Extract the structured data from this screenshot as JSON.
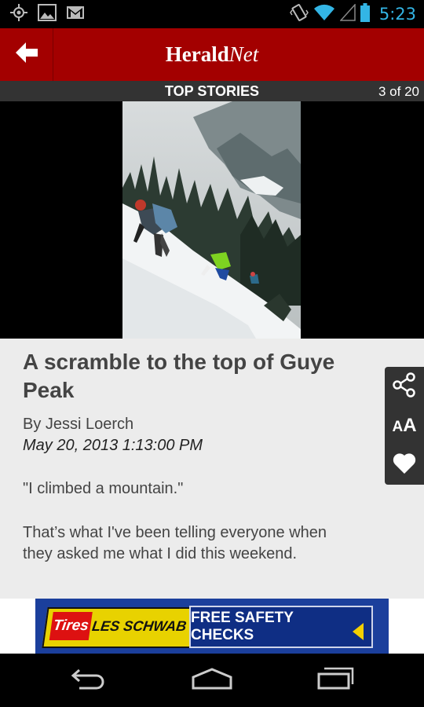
{
  "status_bar": {
    "time": "5:23",
    "icons": [
      "gps-icon",
      "image-icon",
      "gmail-icon",
      "vibrate-icon",
      "wifi-icon",
      "signal-icon",
      "battery-icon"
    ]
  },
  "header": {
    "logo_bold": "Herald",
    "logo_italic": "Net",
    "back_icon": "back-arrow-icon",
    "brand_color": "#a30000"
  },
  "section": {
    "title": "TOP STORIES",
    "counter": "3 of 20"
  },
  "article": {
    "headline": "A scramble to the top of Guye Peak",
    "byline": "By Jessi Loerch",
    "date": "May 20, 2013 1:13:00 PM",
    "paragraphs": [
      "\"I climbed a mountain.\"",
      "That’s what I've been telling everyone when they asked me what I did this weekend."
    ]
  },
  "tools": {
    "font_size_label_small": "A",
    "font_size_label_large": "A",
    "icons": [
      "share-icon",
      "font-size-icon",
      "heart-icon"
    ]
  },
  "ad": {
    "tires_text": "Tires",
    "brand": "LES SCHWAB",
    "cta": "FREE SAFETY CHECKS"
  },
  "nav": {
    "icons": [
      "back-nav-icon",
      "home-icon",
      "recent-apps-icon"
    ]
  }
}
